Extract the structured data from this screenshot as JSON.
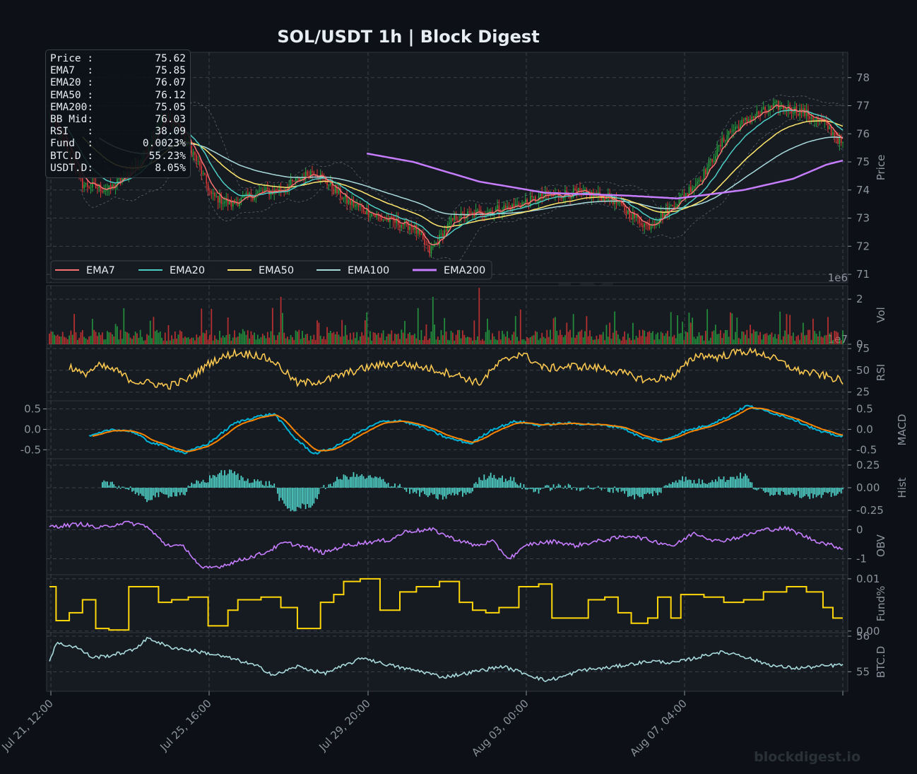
{
  "title": "SOL/USDT  1h  |  Block Digest",
  "watermark": {
    "center": "blockdigest.io",
    "corner": "blockdigest.io"
  },
  "colors": {
    "bg": "#0d1117",
    "panel": "#161b22",
    "grid": "#30363d",
    "text": "#8b949e",
    "title": "#e6edf3",
    "up": "#26a641",
    "down": "#da3633",
    "ema7": "#f97171",
    "ema20": "#4ecdc4",
    "ema50": "#ffe66d",
    "ema100": "#a8dadc",
    "ema200": "#c77dff",
    "rsi": "#f9c74f",
    "macd": "#00b4d8",
    "signal": "#fb8500",
    "hist": "#4ecdc4",
    "obv": "#c77dff",
    "fund": "#ffd60a",
    "btcd": "#a8dadc"
  },
  "infobox": [
    {
      "label": "Price :",
      "value": "75.62"
    },
    {
      "label": "EMA7  :",
      "value": "75.85"
    },
    {
      "label": "EMA20 :",
      "value": "76.07"
    },
    {
      "label": "EMA50 :",
      "value": "76.12"
    },
    {
      "label": "EMA200:",
      "value": "75.05"
    },
    {
      "label": "BB Mid:",
      "value": "76.03"
    },
    {
      "label": "RSI   :",
      "value": "38.09"
    },
    {
      "label": "Fund  :",
      "value": "0.0023%"
    },
    {
      "label": "BTC.D :",
      "value": "55.23%"
    },
    {
      "label": "USDT.D:",
      "value": "8.05%"
    }
  ],
  "chart_data": {
    "type": "line",
    "x_ticks": [
      "Jul 21, 12:00",
      "Jul 25, 16:00",
      "Jul 29, 20:00",
      "Aug 03, 00:00",
      "Aug 07, 04:00"
    ],
    "legend": [
      "EMA7",
      "EMA20",
      "EMA50",
      "EMA100",
      "EMA200"
    ],
    "panels": {
      "price": {
        "ylabel": "Price",
        "ylim": [
          70.7,
          78.9
        ],
        "ticks": [
          71,
          72,
          73,
          74,
          75,
          76,
          77,
          78
        ],
        "offset_text": "1e6",
        "close_keypoints": [
          [
            0,
            76.6
          ],
          [
            8,
            75.8
          ],
          [
            20,
            74.2
          ],
          [
            36,
            74.0
          ],
          [
            55,
            75.0
          ],
          [
            68,
            76.6
          ],
          [
            78,
            76.3
          ],
          [
            88,
            75.2
          ],
          [
            98,
            73.8
          ],
          [
            110,
            73.5
          ],
          [
            126,
            73.9
          ],
          [
            140,
            74.0
          ],
          [
            160,
            74.7
          ],
          [
            180,
            73.6
          ],
          [
            200,
            73.0
          ],
          [
            220,
            72.7
          ],
          [
            230,
            71.8
          ],
          [
            245,
            73.0
          ],
          [
            260,
            73.2
          ],
          [
            280,
            73.4
          ],
          [
            300,
            73.8
          ],
          [
            320,
            73.9
          ],
          [
            340,
            73.7
          ],
          [
            350,
            73.2
          ],
          [
            362,
            72.7
          ],
          [
            380,
            73.6
          ],
          [
            395,
            74.5
          ],
          [
            410,
            76.0
          ],
          [
            425,
            76.6
          ],
          [
            440,
            77.0
          ],
          [
            455,
            76.8
          ],
          [
            470,
            76.3
          ],
          [
            480,
            75.6
          ]
        ],
        "ema200_keypoints": [
          [
            192,
            75.3
          ],
          [
            220,
            75.0
          ],
          [
            260,
            74.3
          ],
          [
            300,
            73.9
          ],
          [
            350,
            73.8
          ],
          [
            380,
            73.7
          ],
          [
            420,
            74.0
          ],
          [
            450,
            74.4
          ],
          [
            470,
            74.9
          ],
          [
            480,
            75.05
          ]
        ]
      },
      "vol": {
        "ylabel": "Vol",
        "ticks": [
          0,
          2
        ],
        "ylim": [
          0,
          2.6
        ],
        "offset_text": "1e7"
      },
      "rsi": {
        "ylabel": "RSI",
        "ticks": [
          25,
          50,
          75
        ],
        "ylim": [
          15,
          80
        ],
        "keypoints": [
          [
            12,
            55
          ],
          [
            20,
            45
          ],
          [
            30,
            55
          ],
          [
            40,
            50
          ],
          [
            50,
            38
          ],
          [
            62,
            35
          ],
          [
            72,
            32
          ],
          [
            84,
            40
          ],
          [
            98,
            60
          ],
          [
            112,
            70
          ],
          [
            125,
            68
          ],
          [
            136,
            60
          ],
          [
            150,
            35
          ],
          [
            166,
            38
          ],
          [
            182,
            48
          ],
          [
            196,
            55
          ],
          [
            212,
            58
          ],
          [
            230,
            52
          ],
          [
            246,
            45
          ],
          [
            260,
            35
          ],
          [
            272,
            58
          ],
          [
            285,
            70
          ],
          [
            300,
            52
          ],
          [
            318,
            55
          ],
          [
            336,
            52
          ],
          [
            352,
            44
          ],
          [
            362,
            38
          ],
          [
            378,
            44
          ],
          [
            392,
            68
          ],
          [
            405,
            65
          ],
          [
            418,
            72
          ],
          [
            430,
            70
          ],
          [
            440,
            62
          ],
          [
            452,
            50
          ],
          [
            466,
            45
          ],
          [
            480,
            38
          ]
        ]
      },
      "macd": {
        "ylabel": "MACD",
        "ticks": [
          -0.5,
          0.0,
          0.5
        ],
        "ylim": [
          -0.72,
          0.7
        ],
        "keypoints": [
          [
            24,
            -0.18
          ],
          [
            38,
            0.0
          ],
          [
            50,
            -0.05
          ],
          [
            60,
            -0.3
          ],
          [
            72,
            -0.45
          ],
          [
            82,
            -0.58
          ],
          [
            96,
            -0.35
          ],
          [
            112,
            0.15
          ],
          [
            124,
            0.3
          ],
          [
            136,
            0.38
          ],
          [
            148,
            -0.2
          ],
          [
            160,
            -0.6
          ],
          [
            172,
            -0.45
          ],
          [
            186,
            -0.1
          ],
          [
            200,
            0.18
          ],
          [
            212,
            0.22
          ],
          [
            226,
            0.05
          ],
          [
            240,
            -0.2
          ],
          [
            255,
            -0.35
          ],
          [
            268,
            0.0
          ],
          [
            282,
            0.2
          ],
          [
            296,
            0.1
          ],
          [
            312,
            0.15
          ],
          [
            330,
            0.12
          ],
          [
            346,
            0.05
          ],
          [
            358,
            -0.2
          ],
          [
            370,
            -0.3
          ],
          [
            384,
            -0.05
          ],
          [
            398,
            0.1
          ],
          [
            410,
            0.3
          ],
          [
            422,
            0.58
          ],
          [
            436,
            0.42
          ],
          [
            450,
            0.25
          ],
          [
            466,
            -0.05
          ],
          [
            480,
            -0.18
          ]
        ]
      },
      "hist": {
        "ylabel": "Hist",
        "ticks": [
          -0.25,
          0.0,
          0.25
        ],
        "ylim": [
          -0.32,
          0.32
        ]
      },
      "obv": {
        "ylabel": "OBV",
        "ticks": [
          -1,
          0
        ],
        "ylim": [
          -1.55,
          0.45
        ],
        "keypoints": [
          [
            0,
            0.1
          ],
          [
            20,
            0.2
          ],
          [
            30,
            0.05
          ],
          [
            45,
            0.25
          ],
          [
            58,
            0.15
          ],
          [
            70,
            -0.5
          ],
          [
            82,
            -0.6
          ],
          [
            92,
            -1.35
          ],
          [
            104,
            -1.25
          ],
          [
            118,
            -1.0
          ],
          [
            130,
            -0.8
          ],
          [
            142,
            -0.45
          ],
          [
            152,
            -0.55
          ],
          [
            166,
            -0.8
          ],
          [
            178,
            -0.55
          ],
          [
            190,
            -0.45
          ],
          [
            206,
            -0.35
          ],
          [
            216,
            -0.05
          ],
          [
            232,
            0.0
          ],
          [
            244,
            -0.3
          ],
          [
            258,
            -0.55
          ],
          [
            268,
            -0.4
          ],
          [
            278,
            -1.0
          ],
          [
            290,
            -0.5
          ],
          [
            306,
            -0.4
          ],
          [
            318,
            -0.55
          ],
          [
            336,
            -0.35
          ],
          [
            352,
            -0.2
          ],
          [
            366,
            -0.4
          ],
          [
            378,
            -0.55
          ],
          [
            390,
            -0.1
          ],
          [
            404,
            -0.4
          ],
          [
            418,
            -0.25
          ],
          [
            432,
            0.0
          ],
          [
            446,
            0.05
          ],
          [
            462,
            -0.35
          ],
          [
            480,
            -0.65
          ]
        ]
      },
      "fund": {
        "ylabel": "Fund%",
        "ticks": [
          0.0,
          0.01
        ],
        "ylim": [
          -0.0003,
          0.0108
        ],
        "steps": [
          [
            0,
            0.0085
          ],
          [
            4,
            0.002
          ],
          [
            12,
            0.0035
          ],
          [
            20,
            0.006
          ],
          [
            28,
            0.0005
          ],
          [
            36,
            0.0002
          ],
          [
            48,
            0.0085
          ],
          [
            66,
            0.0055
          ],
          [
            74,
            0.006
          ],
          [
            84,
            0.0065
          ],
          [
            96,
            0.001
          ],
          [
            108,
            0.004
          ],
          [
            114,
            0.006
          ],
          [
            128,
            0.0065
          ],
          [
            140,
            0.0045
          ],
          [
            150,
            0.0005
          ],
          [
            164,
            0.0055
          ],
          [
            172,
            0.007
          ],
          [
            178,
            0.0095
          ],
          [
            188,
            0.01
          ],
          [
            200,
            0.004
          ],
          [
            212,
            0.0075
          ],
          [
            222,
            0.0085
          ],
          [
            236,
            0.0095
          ],
          [
            248,
            0.0055
          ],
          [
            256,
            0.004
          ],
          [
            264,
            0.0035
          ],
          [
            272,
            0.0045
          ],
          [
            284,
            0.0085
          ],
          [
            296,
            0.009
          ],
          [
            304,
            0.0025
          ],
          [
            316,
            0.0025
          ],
          [
            326,
            0.006
          ],
          [
            336,
            0.0065
          ],
          [
            344,
            0.0035
          ],
          [
            352,
            0.0015
          ],
          [
            362,
            0.0025
          ],
          [
            368,
            0.0065
          ],
          [
            376,
            0.0025
          ],
          [
            382,
            0.007
          ],
          [
            396,
            0.0065
          ],
          [
            408,
            0.0055
          ],
          [
            420,
            0.006
          ],
          [
            432,
            0.0075
          ],
          [
            446,
            0.0085
          ],
          [
            458,
            0.0075
          ],
          [
            468,
            0.0045
          ],
          [
            474,
            0.0025
          ],
          [
            480,
            0.0025
          ]
        ]
      },
      "btcd": {
        "ylabel": "BTC.D",
        "ticks": [
          55,
          56
        ],
        "ylim": [
          54.45,
          56.1
        ],
        "keypoints": [
          [
            0,
            55.3
          ],
          [
            4,
            55.8
          ],
          [
            16,
            55.7
          ],
          [
            26,
            55.4
          ],
          [
            36,
            55.45
          ],
          [
            50,
            55.6
          ],
          [
            60,
            55.95
          ],
          [
            72,
            55.7
          ],
          [
            86,
            55.6
          ],
          [
            98,
            55.5
          ],
          [
            112,
            55.35
          ],
          [
            126,
            55.15
          ],
          [
            136,
            54.9
          ],
          [
            150,
            55.15
          ],
          [
            166,
            54.95
          ],
          [
            180,
            55.2
          ],
          [
            190,
            55.4
          ],
          [
            200,
            55.25
          ],
          [
            214,
            55.1
          ],
          [
            226,
            55.0
          ],
          [
            238,
            54.85
          ],
          [
            252,
            54.95
          ],
          [
            262,
            55.05
          ],
          [
            274,
            55.15
          ],
          [
            288,
            54.95
          ],
          [
            300,
            54.75
          ],
          [
            310,
            54.85
          ],
          [
            322,
            55.05
          ],
          [
            336,
            55.1
          ],
          [
            350,
            55.2
          ],
          [
            364,
            55.3
          ],
          [
            378,
            55.25
          ],
          [
            392,
            55.4
          ],
          [
            404,
            55.55
          ],
          [
            416,
            55.5
          ],
          [
            428,
            55.3
          ],
          [
            440,
            55.15
          ],
          [
            452,
            55.1
          ],
          [
            466,
            55.15
          ],
          [
            480,
            55.2
          ]
        ]
      }
    }
  }
}
